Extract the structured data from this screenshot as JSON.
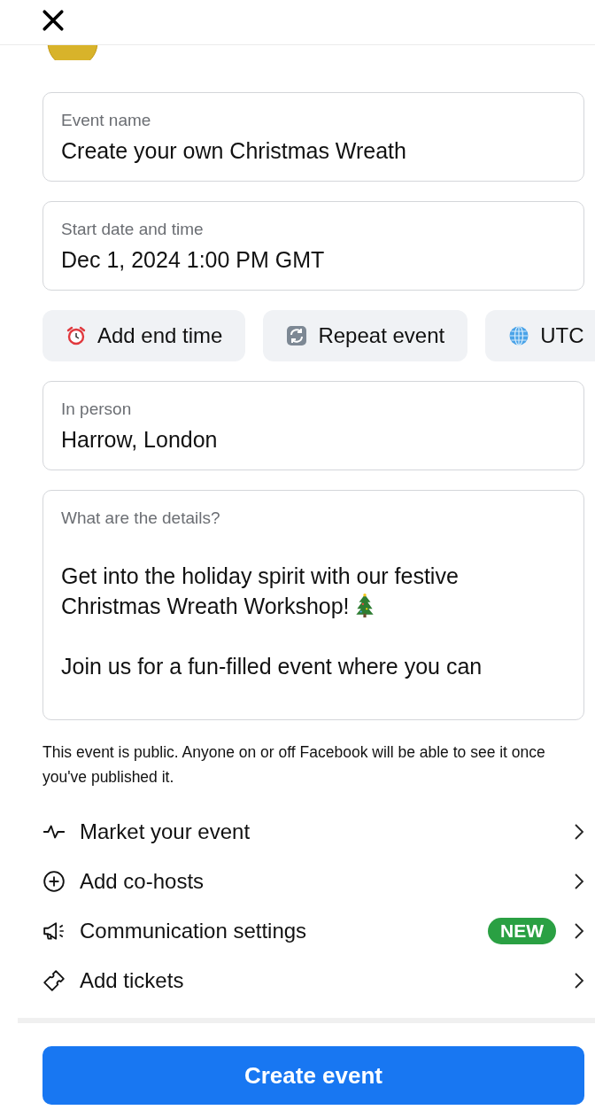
{
  "fields": [
    {
      "label": "Event name",
      "value": "Create your own Christmas Wreath"
    },
    {
      "label": "Start date and time",
      "value": "Dec 1, 2024 1:00 PM GMT"
    }
  ],
  "chips": [
    {
      "kind": "end-time",
      "label": "Add end time"
    },
    {
      "kind": "repeat",
      "label": "Repeat event"
    },
    {
      "kind": "timezone",
      "label": "UTC"
    }
  ],
  "location": {
    "label": "In person",
    "value": "Harrow, London"
  },
  "details": {
    "placeholder": "What are the details?",
    "paragraphs": [
      "Get into the holiday spirit with our festive Christmas Wreath Workshop!",
      "Join us for a fun-filled event where you can"
    ]
  },
  "privacy_note": "This event is public. Anyone on or off Facebook will be able to see it once you've published it.",
  "options": [
    {
      "kind": "market",
      "label": "Market your event"
    },
    {
      "kind": "cohosts",
      "label": "Add co-hosts"
    },
    {
      "kind": "communication",
      "label": "Communication settings",
      "badge": "NEW"
    },
    {
      "kind": "tickets",
      "label": "Add tickets"
    }
  ],
  "submit": "Create event"
}
